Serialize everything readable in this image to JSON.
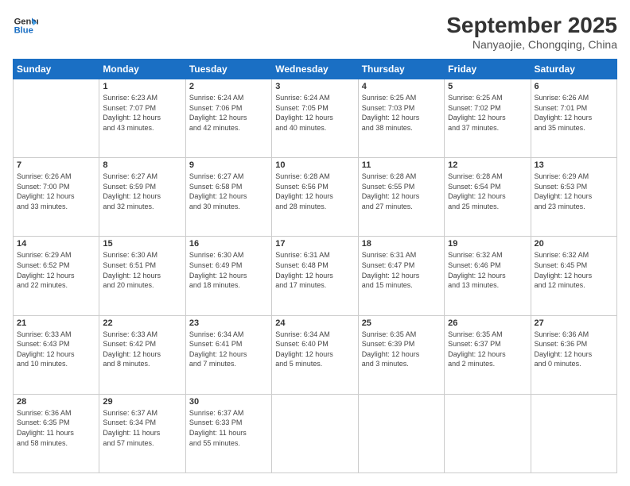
{
  "logo": {
    "line1": "General",
    "line2": "Blue"
  },
  "title": "September 2025",
  "subtitle": "Nanyaojie, Chongqing, China",
  "days": [
    "Sunday",
    "Monday",
    "Tuesday",
    "Wednesday",
    "Thursday",
    "Friday",
    "Saturday"
  ],
  "weeks": [
    [
      {
        "day": "",
        "info": ""
      },
      {
        "day": "1",
        "info": "Sunrise: 6:23 AM\nSunset: 7:07 PM\nDaylight: 12 hours\nand 43 minutes."
      },
      {
        "day": "2",
        "info": "Sunrise: 6:24 AM\nSunset: 7:06 PM\nDaylight: 12 hours\nand 42 minutes."
      },
      {
        "day": "3",
        "info": "Sunrise: 6:24 AM\nSunset: 7:05 PM\nDaylight: 12 hours\nand 40 minutes."
      },
      {
        "day": "4",
        "info": "Sunrise: 6:25 AM\nSunset: 7:03 PM\nDaylight: 12 hours\nand 38 minutes."
      },
      {
        "day": "5",
        "info": "Sunrise: 6:25 AM\nSunset: 7:02 PM\nDaylight: 12 hours\nand 37 minutes."
      },
      {
        "day": "6",
        "info": "Sunrise: 6:26 AM\nSunset: 7:01 PM\nDaylight: 12 hours\nand 35 minutes."
      }
    ],
    [
      {
        "day": "7",
        "info": "Sunrise: 6:26 AM\nSunset: 7:00 PM\nDaylight: 12 hours\nand 33 minutes."
      },
      {
        "day": "8",
        "info": "Sunrise: 6:27 AM\nSunset: 6:59 PM\nDaylight: 12 hours\nand 32 minutes."
      },
      {
        "day": "9",
        "info": "Sunrise: 6:27 AM\nSunset: 6:58 PM\nDaylight: 12 hours\nand 30 minutes."
      },
      {
        "day": "10",
        "info": "Sunrise: 6:28 AM\nSunset: 6:56 PM\nDaylight: 12 hours\nand 28 minutes."
      },
      {
        "day": "11",
        "info": "Sunrise: 6:28 AM\nSunset: 6:55 PM\nDaylight: 12 hours\nand 27 minutes."
      },
      {
        "day": "12",
        "info": "Sunrise: 6:28 AM\nSunset: 6:54 PM\nDaylight: 12 hours\nand 25 minutes."
      },
      {
        "day": "13",
        "info": "Sunrise: 6:29 AM\nSunset: 6:53 PM\nDaylight: 12 hours\nand 23 minutes."
      }
    ],
    [
      {
        "day": "14",
        "info": "Sunrise: 6:29 AM\nSunset: 6:52 PM\nDaylight: 12 hours\nand 22 minutes."
      },
      {
        "day": "15",
        "info": "Sunrise: 6:30 AM\nSunset: 6:51 PM\nDaylight: 12 hours\nand 20 minutes."
      },
      {
        "day": "16",
        "info": "Sunrise: 6:30 AM\nSunset: 6:49 PM\nDaylight: 12 hours\nand 18 minutes."
      },
      {
        "day": "17",
        "info": "Sunrise: 6:31 AM\nSunset: 6:48 PM\nDaylight: 12 hours\nand 17 minutes."
      },
      {
        "day": "18",
        "info": "Sunrise: 6:31 AM\nSunset: 6:47 PM\nDaylight: 12 hours\nand 15 minutes."
      },
      {
        "day": "19",
        "info": "Sunrise: 6:32 AM\nSunset: 6:46 PM\nDaylight: 12 hours\nand 13 minutes."
      },
      {
        "day": "20",
        "info": "Sunrise: 6:32 AM\nSunset: 6:45 PM\nDaylight: 12 hours\nand 12 minutes."
      }
    ],
    [
      {
        "day": "21",
        "info": "Sunrise: 6:33 AM\nSunset: 6:43 PM\nDaylight: 12 hours\nand 10 minutes."
      },
      {
        "day": "22",
        "info": "Sunrise: 6:33 AM\nSunset: 6:42 PM\nDaylight: 12 hours\nand 8 minutes."
      },
      {
        "day": "23",
        "info": "Sunrise: 6:34 AM\nSunset: 6:41 PM\nDaylight: 12 hours\nand 7 minutes."
      },
      {
        "day": "24",
        "info": "Sunrise: 6:34 AM\nSunset: 6:40 PM\nDaylight: 12 hours\nand 5 minutes."
      },
      {
        "day": "25",
        "info": "Sunrise: 6:35 AM\nSunset: 6:39 PM\nDaylight: 12 hours\nand 3 minutes."
      },
      {
        "day": "26",
        "info": "Sunrise: 6:35 AM\nSunset: 6:37 PM\nDaylight: 12 hours\nand 2 minutes."
      },
      {
        "day": "27",
        "info": "Sunrise: 6:36 AM\nSunset: 6:36 PM\nDaylight: 12 hours\nand 0 minutes."
      }
    ],
    [
      {
        "day": "28",
        "info": "Sunrise: 6:36 AM\nSunset: 6:35 PM\nDaylight: 11 hours\nand 58 minutes."
      },
      {
        "day": "29",
        "info": "Sunrise: 6:37 AM\nSunset: 6:34 PM\nDaylight: 11 hours\nand 57 minutes."
      },
      {
        "day": "30",
        "info": "Sunrise: 6:37 AM\nSunset: 6:33 PM\nDaylight: 11 hours\nand 55 minutes."
      },
      {
        "day": "",
        "info": ""
      },
      {
        "day": "",
        "info": ""
      },
      {
        "day": "",
        "info": ""
      },
      {
        "day": "",
        "info": ""
      }
    ]
  ]
}
